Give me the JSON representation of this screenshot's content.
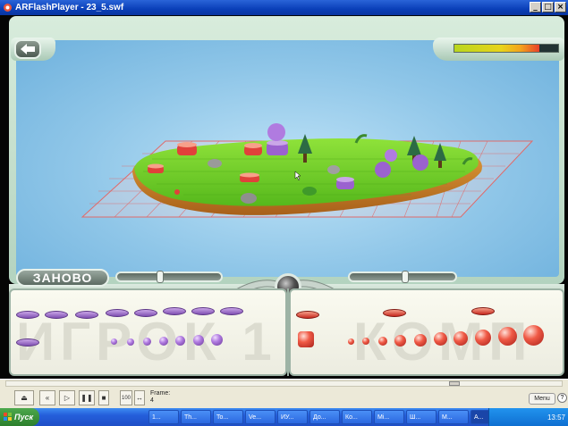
{
  "window": {
    "title": "ARFlashPlayer - 23_5.swf",
    "minimize": "_",
    "maximize": "□",
    "close": "×"
  },
  "game": {
    "restart_label": "ЗАНОВО",
    "player1_label": "ИГРОК 1",
    "computer_label": "КОМП",
    "progress_fraction": 0.82
  },
  "player_controls": {
    "frame_label": "Frame:",
    "frame_value": "4",
    "zoom_value": "100",
    "menu_label": "Menu"
  },
  "taskbar": {
    "start_label": "Пуск",
    "items": [
      "1...",
      "Th...",
      "To...",
      "Ve...",
      "ИУ...",
      "До...",
      "Ко...",
      "Mi...",
      "Ш...",
      "M...",
      "A..."
    ],
    "clock": "13:57"
  },
  "colors": {
    "accent_blue": "#245edb",
    "grid_red": "#e45050",
    "island_green": "#6fcf2a",
    "purple_piece": "#9b62cf",
    "red_piece": "#e0413a"
  }
}
